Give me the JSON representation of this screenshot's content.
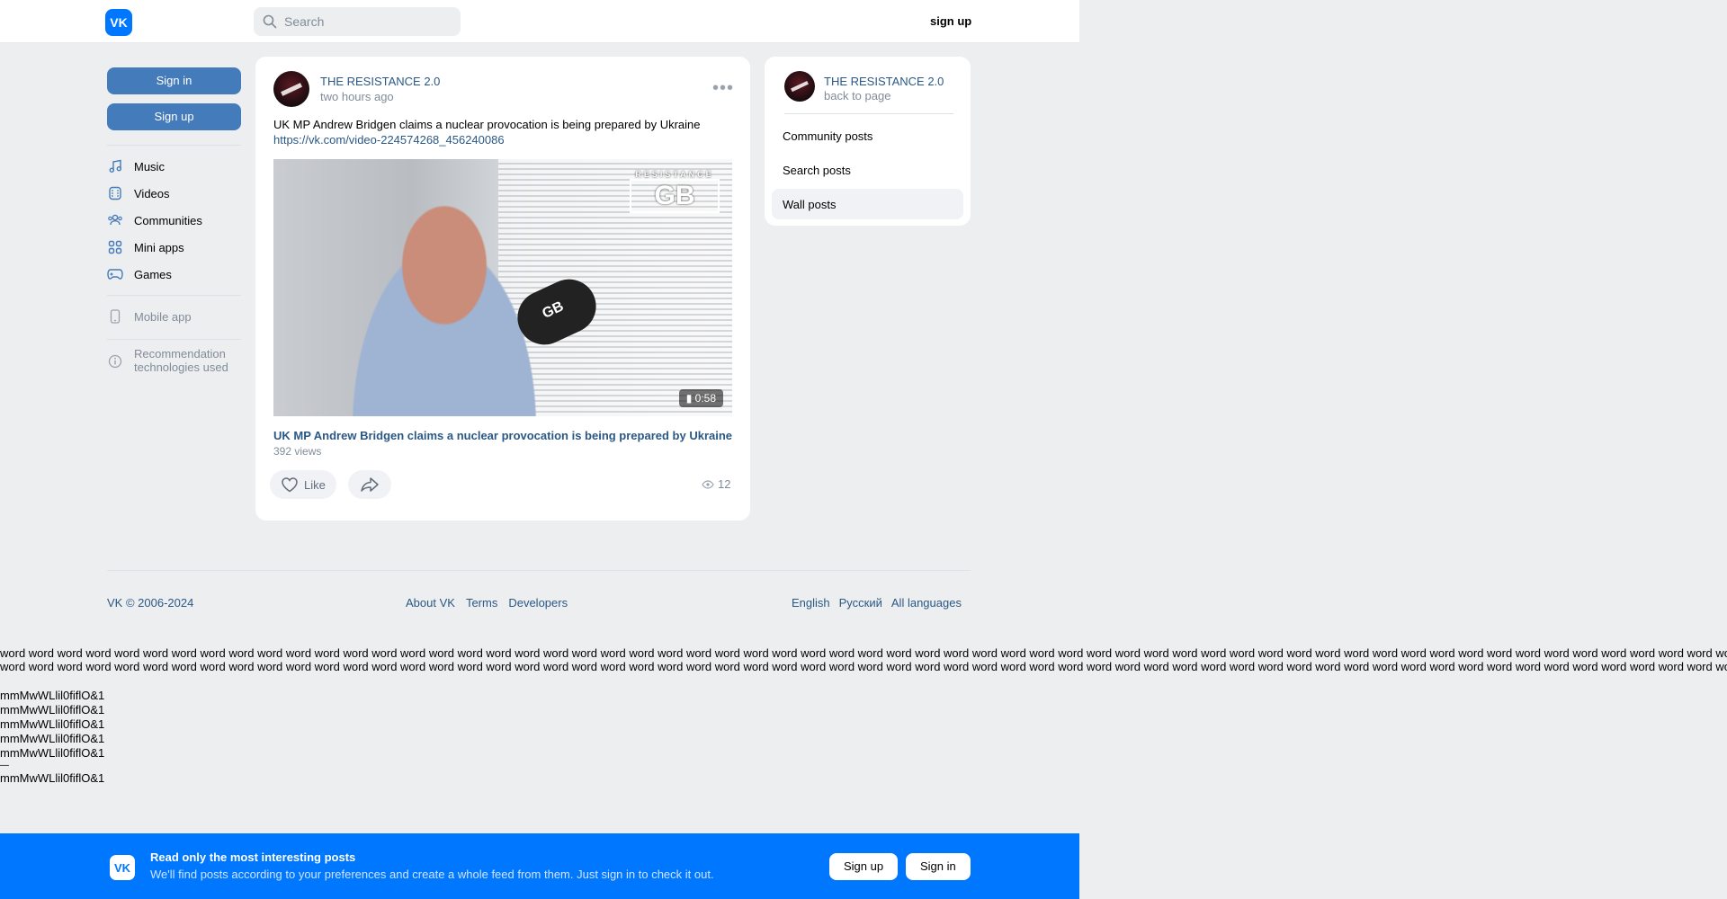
{
  "header": {
    "logo": "VK",
    "search_placeholder": "Search",
    "signup": "sign up"
  },
  "left_nav": {
    "sign_in": "Sign in",
    "sign_up": "Sign up",
    "items": [
      {
        "label": "Music",
        "icon": "music-icon"
      },
      {
        "label": "Videos",
        "icon": "videos-icon"
      },
      {
        "label": "Communities",
        "icon": "communities-icon"
      },
      {
        "label": "Mini apps",
        "icon": "mini-apps-icon"
      },
      {
        "label": "Games",
        "icon": "games-icon"
      }
    ],
    "mobile_app": "Mobile app",
    "recommendation_line1": "Recommendation",
    "recommendation_line2": "technologies used"
  },
  "post": {
    "author": "THE RESISTANCE 2.0",
    "time": "two hours ago",
    "text": "UK MP Andrew Bridgen claims a nuclear provocation is being prepared by Ukraine",
    "link": "https://vk.com/video-224574268_456240086",
    "video": {
      "duration": "0:58",
      "watermark_top": "RESISTANCE",
      "watermark_main": "GB",
      "mic_label": "GB",
      "title": "UK MP Andrew Bridgen claims a nuclear provocation is being prepared by Ukraine",
      "views": "392 views"
    },
    "like_label": "Like",
    "view_count": "12"
  },
  "right_card": {
    "name": "THE RESISTANCE 2.0",
    "back": "back to page",
    "items": [
      "Community posts",
      "Search posts",
      "Wall posts"
    ],
    "active_index": 2
  },
  "footer": {
    "copyright": "VK © 2006-2024",
    "links": [
      "About VK",
      "Terms",
      "Developers"
    ],
    "languages": [
      "English",
      "Русский",
      "All languages"
    ]
  },
  "test_text": {
    "word_line": "word word word word word word word word word word word word word word word word word word word word word word word word word word word word word word word word word word word word word word word word word word word word word word word word word word word word word word word word word word word word word word word word word word word word word word word word word word word word word word word word word word word word word word word",
    "glyph_line": "mmMwWLlil0fiflO&1",
    "dash": "—"
  },
  "banner": {
    "logo": "VK",
    "title": "Read only the most interesting posts",
    "subtitle": "We'll find posts according to your preferences and create a whole feed from them. Just sign in to check it out.",
    "sign_up": "Sign up",
    "sign_in": "Sign in"
  },
  "colors": {
    "brand": "#0077ff",
    "link": "#2a5885",
    "button": "#447bba",
    "background": "#edeef0"
  }
}
